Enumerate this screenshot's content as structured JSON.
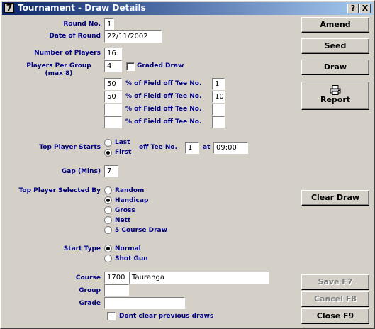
{
  "window": {
    "icon_glyph": "7",
    "title": "Tournament - Draw Details",
    "help_btn": "?",
    "close_btn": "X"
  },
  "round": {
    "label": "Round No.",
    "value": "1"
  },
  "date": {
    "label": "Date of Round",
    "value": "22/11/2002"
  },
  "players": {
    "label": "Number of Players",
    "value": "16"
  },
  "per_group": {
    "label_line1": "Players Per Group",
    "label_line2": "(max 8)",
    "value": "4"
  },
  "graded_draw": {
    "label": "Graded Draw",
    "checked": false
  },
  "field_rows": [
    {
      "pct": "50",
      "label": "% of Field off Tee No.",
      "tee": "1"
    },
    {
      "pct": "50",
      "label": "% of Field off Tee No.",
      "tee": "10"
    },
    {
      "pct": "",
      "label": "% of Field off Tee No.",
      "tee": ""
    },
    {
      "pct": "",
      "label": "% of Field off Tee No.",
      "tee": ""
    }
  ],
  "top_player_starts": {
    "label": "Top Player Starts",
    "options": [
      "Last",
      "First"
    ],
    "selected": "First",
    "tee_label": "off Tee No.",
    "tee_value": "1",
    "at_label": "at",
    "time_value": "09:00"
  },
  "gap": {
    "label": "Gap (Mins)",
    "value": "7"
  },
  "selected_by": {
    "label": "Top Player Selected By",
    "options": [
      "Random",
      "Handicap",
      "Gross",
      "Nett",
      "5 Course Draw"
    ],
    "selected": "Handicap"
  },
  "start_type": {
    "label": "Start Type",
    "options": [
      "Normal",
      "Shot Gun"
    ],
    "selected": "Normal"
  },
  "course": {
    "label": "Course",
    "code": "1700",
    "name": "Tauranga"
  },
  "group": {
    "label": "Group",
    "value": ""
  },
  "grade": {
    "label": "Grade",
    "value": ""
  },
  "dont_clear": {
    "label": "Dont clear previous draws",
    "checked": false
  },
  "buttons": {
    "amend": "Amend",
    "seed": "Seed",
    "draw": "Draw",
    "report": "Report",
    "clear_draw": "Clear Draw",
    "save": "Save F7",
    "cancel": "Cancel F8",
    "close": "Close F9"
  },
  "colors": {
    "label": "#000080",
    "titlebar_start": "#0a246a",
    "titlebar_end": "#a6caf0"
  }
}
